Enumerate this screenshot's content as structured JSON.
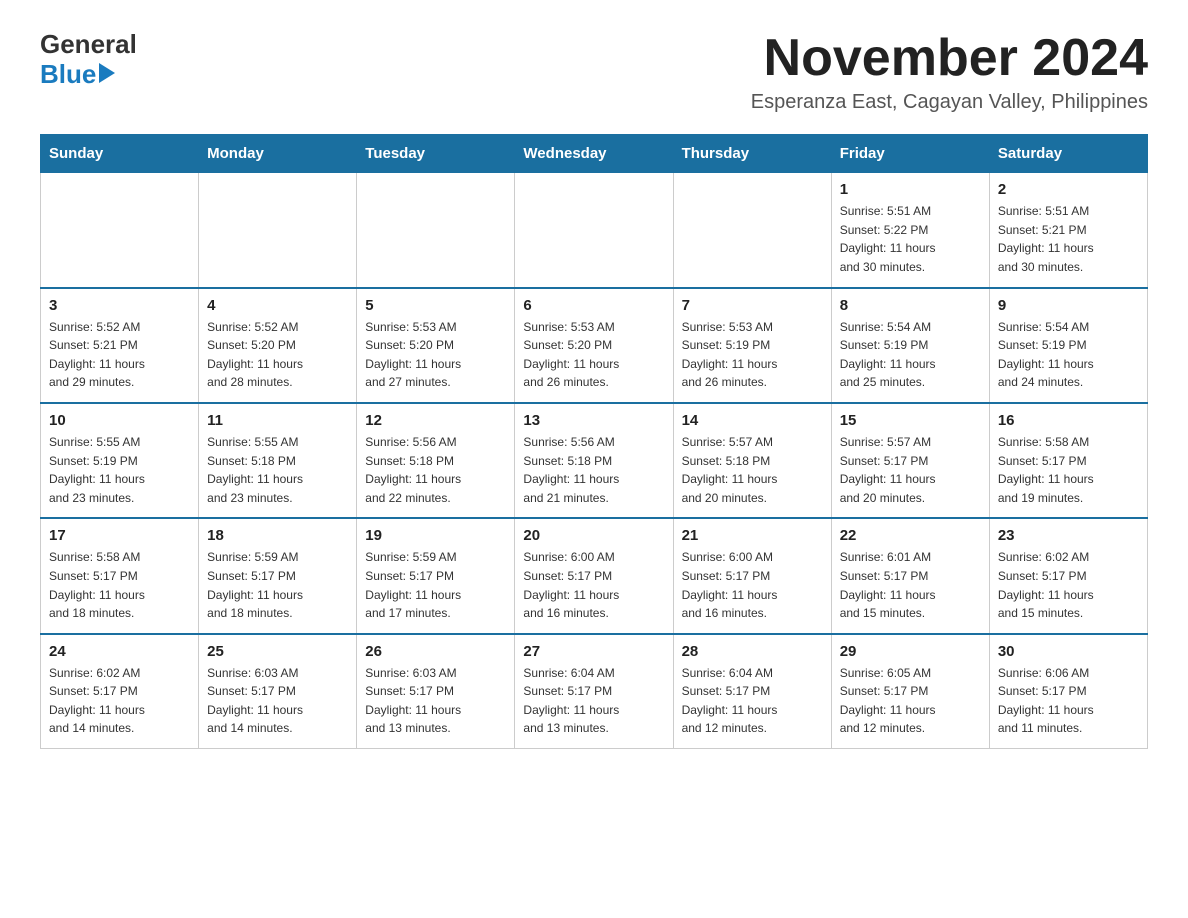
{
  "logo": {
    "general": "General",
    "blue": "Blue"
  },
  "header": {
    "month_title": "November 2024",
    "location": "Esperanza East, Cagayan Valley, Philippines"
  },
  "days_of_week": [
    "Sunday",
    "Monday",
    "Tuesday",
    "Wednesday",
    "Thursday",
    "Friday",
    "Saturday"
  ],
  "weeks": [
    {
      "days": [
        {
          "number": "",
          "info": ""
        },
        {
          "number": "",
          "info": ""
        },
        {
          "number": "",
          "info": ""
        },
        {
          "number": "",
          "info": ""
        },
        {
          "number": "",
          "info": ""
        },
        {
          "number": "1",
          "info": "Sunrise: 5:51 AM\nSunset: 5:22 PM\nDaylight: 11 hours\nand 30 minutes."
        },
        {
          "number": "2",
          "info": "Sunrise: 5:51 AM\nSunset: 5:21 PM\nDaylight: 11 hours\nand 30 minutes."
        }
      ]
    },
    {
      "days": [
        {
          "number": "3",
          "info": "Sunrise: 5:52 AM\nSunset: 5:21 PM\nDaylight: 11 hours\nand 29 minutes."
        },
        {
          "number": "4",
          "info": "Sunrise: 5:52 AM\nSunset: 5:20 PM\nDaylight: 11 hours\nand 28 minutes."
        },
        {
          "number": "5",
          "info": "Sunrise: 5:53 AM\nSunset: 5:20 PM\nDaylight: 11 hours\nand 27 minutes."
        },
        {
          "number": "6",
          "info": "Sunrise: 5:53 AM\nSunset: 5:20 PM\nDaylight: 11 hours\nand 26 minutes."
        },
        {
          "number": "7",
          "info": "Sunrise: 5:53 AM\nSunset: 5:19 PM\nDaylight: 11 hours\nand 26 minutes."
        },
        {
          "number": "8",
          "info": "Sunrise: 5:54 AM\nSunset: 5:19 PM\nDaylight: 11 hours\nand 25 minutes."
        },
        {
          "number": "9",
          "info": "Sunrise: 5:54 AM\nSunset: 5:19 PM\nDaylight: 11 hours\nand 24 minutes."
        }
      ]
    },
    {
      "days": [
        {
          "number": "10",
          "info": "Sunrise: 5:55 AM\nSunset: 5:19 PM\nDaylight: 11 hours\nand 23 minutes."
        },
        {
          "number": "11",
          "info": "Sunrise: 5:55 AM\nSunset: 5:18 PM\nDaylight: 11 hours\nand 23 minutes."
        },
        {
          "number": "12",
          "info": "Sunrise: 5:56 AM\nSunset: 5:18 PM\nDaylight: 11 hours\nand 22 minutes."
        },
        {
          "number": "13",
          "info": "Sunrise: 5:56 AM\nSunset: 5:18 PM\nDaylight: 11 hours\nand 21 minutes."
        },
        {
          "number": "14",
          "info": "Sunrise: 5:57 AM\nSunset: 5:18 PM\nDaylight: 11 hours\nand 20 minutes."
        },
        {
          "number": "15",
          "info": "Sunrise: 5:57 AM\nSunset: 5:17 PM\nDaylight: 11 hours\nand 20 minutes."
        },
        {
          "number": "16",
          "info": "Sunrise: 5:58 AM\nSunset: 5:17 PM\nDaylight: 11 hours\nand 19 minutes."
        }
      ]
    },
    {
      "days": [
        {
          "number": "17",
          "info": "Sunrise: 5:58 AM\nSunset: 5:17 PM\nDaylight: 11 hours\nand 18 minutes."
        },
        {
          "number": "18",
          "info": "Sunrise: 5:59 AM\nSunset: 5:17 PM\nDaylight: 11 hours\nand 18 minutes."
        },
        {
          "number": "19",
          "info": "Sunrise: 5:59 AM\nSunset: 5:17 PM\nDaylight: 11 hours\nand 17 minutes."
        },
        {
          "number": "20",
          "info": "Sunrise: 6:00 AM\nSunset: 5:17 PM\nDaylight: 11 hours\nand 16 minutes."
        },
        {
          "number": "21",
          "info": "Sunrise: 6:00 AM\nSunset: 5:17 PM\nDaylight: 11 hours\nand 16 minutes."
        },
        {
          "number": "22",
          "info": "Sunrise: 6:01 AM\nSunset: 5:17 PM\nDaylight: 11 hours\nand 15 minutes."
        },
        {
          "number": "23",
          "info": "Sunrise: 6:02 AM\nSunset: 5:17 PM\nDaylight: 11 hours\nand 15 minutes."
        }
      ]
    },
    {
      "days": [
        {
          "number": "24",
          "info": "Sunrise: 6:02 AM\nSunset: 5:17 PM\nDaylight: 11 hours\nand 14 minutes."
        },
        {
          "number": "25",
          "info": "Sunrise: 6:03 AM\nSunset: 5:17 PM\nDaylight: 11 hours\nand 14 minutes."
        },
        {
          "number": "26",
          "info": "Sunrise: 6:03 AM\nSunset: 5:17 PM\nDaylight: 11 hours\nand 13 minutes."
        },
        {
          "number": "27",
          "info": "Sunrise: 6:04 AM\nSunset: 5:17 PM\nDaylight: 11 hours\nand 13 minutes."
        },
        {
          "number": "28",
          "info": "Sunrise: 6:04 AM\nSunset: 5:17 PM\nDaylight: 11 hours\nand 12 minutes."
        },
        {
          "number": "29",
          "info": "Sunrise: 6:05 AM\nSunset: 5:17 PM\nDaylight: 11 hours\nand 12 minutes."
        },
        {
          "number": "30",
          "info": "Sunrise: 6:06 AM\nSunset: 5:17 PM\nDaylight: 11 hours\nand 11 minutes."
        }
      ]
    }
  ]
}
